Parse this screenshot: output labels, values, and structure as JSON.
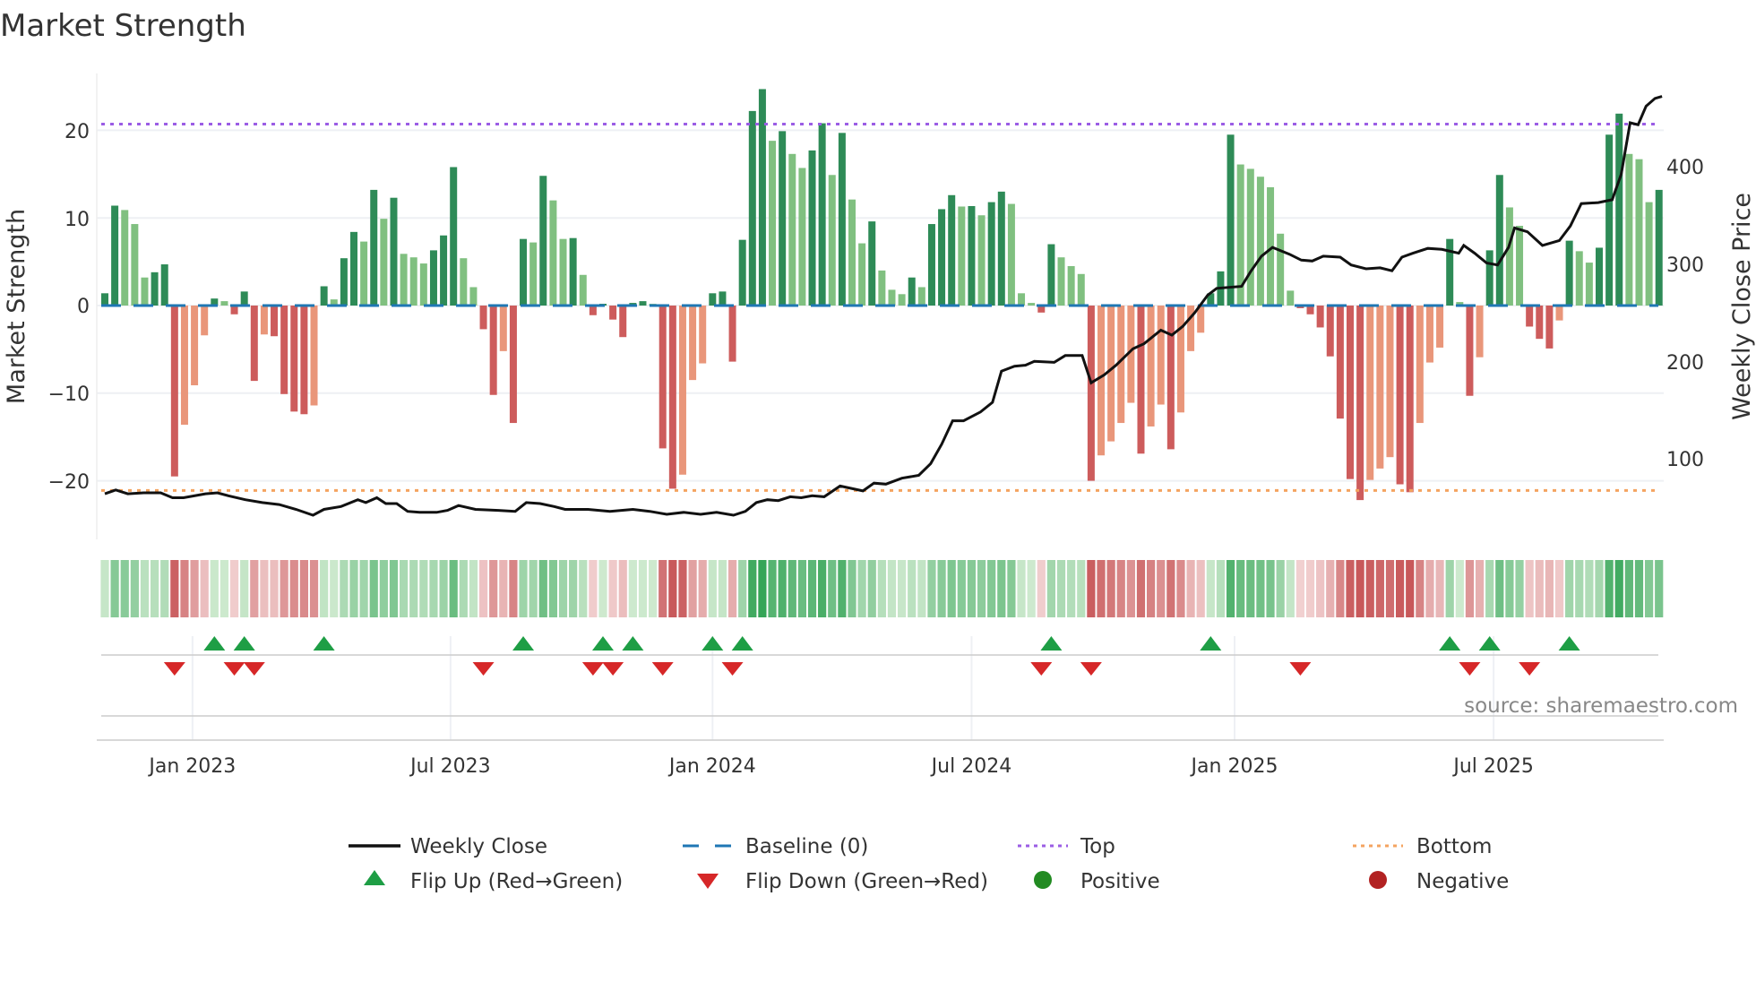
{
  "chart_data": {
    "type": "bar",
    "title": "Market Strength",
    "ylabel": "Market Strength",
    "y2label": "Weekly Close Price",
    "ylim": [
      -26.9,
      26.5
    ],
    "y2lim": [
      0,
      490
    ],
    "y_ticks": [
      "20",
      "10",
      "0",
      "−10",
      "−20"
    ],
    "y_tick_values": [
      20,
      10,
      0,
      -10,
      -20
    ],
    "y2_ticks": [
      "400",
      "300",
      "200",
      "100"
    ],
    "y2_tick_values": [
      400,
      300,
      200,
      100
    ],
    "x_ticks": [
      "Jan 2023",
      "Jul 2023",
      "Jan 2024",
      "Jul 2024",
      "Jan 2025",
      "Jul 2025"
    ],
    "x_tick_weeks": [
      8.8,
      34.7,
      61,
      87,
      113.4,
      139.4
    ],
    "top_level": 20.7,
    "bottom_level": -21.1,
    "baseline": 0,
    "strength_values": [
      1.4,
      11.4,
      10.9,
      9.3,
      3.2,
      3.8,
      4.7,
      -19.5,
      -13.6,
      -9.1,
      -3.4,
      0.8,
      0.5,
      -1.0,
      1.6,
      -8.6,
      -3.3,
      -3.5,
      -10.1,
      -12.1,
      -12.4,
      -11.4,
      2.2,
      0.7,
      5.4,
      8.4,
      7.3,
      13.2,
      9.9,
      12.3,
      5.9,
      5.5,
      4.8,
      6.3,
      8.0,
      15.8,
      5.4,
      2.1,
      -2.7,
      -10.2,
      -5.2,
      -13.4,
      7.6,
      7.2,
      14.8,
      12.0,
      7.6,
      7.7,
      3.5,
      -1.1,
      0.2,
      -1.6,
      -3.6,
      0.3,
      0.5,
      0.2,
      -16.3,
      -20.9,
      -19.3,
      -8.5,
      -6.6,
      1.4,
      1.6,
      -6.4,
      7.5,
      22.2,
      24.7,
      18.8,
      19.9,
      17.3,
      15.7,
      17.7,
      20.8,
      14.9,
      19.7,
      12.1,
      7.1,
      9.6,
      4.0,
      1.8,
      1.3,
      3.2,
      2.1,
      9.3,
      11.0,
      12.6,
      11.3,
      11.35,
      10.3,
      11.8,
      13.0,
      11.6,
      1.4,
      0.3,
      -0.8,
      7.0,
      5.5,
      4.5,
      3.6,
      -20.0,
      -17.1,
      -15.5,
      -13.4,
      -11.1,
      -16.9,
      -13.8,
      -11.3,
      -16.4,
      -12.2,
      -5.2,
      -3.1,
      1.4,
      3.9,
      19.5,
      16.1,
      15.6,
      14.7,
      13.5,
      8.2,
      1.7,
      -0.3,
      -1.0,
      -2.5,
      -5.8,
      -12.9,
      -19.8,
      -22.2,
      -19.9,
      -18.6,
      -17.3,
      -20.4,
      -21.3,
      -13.4,
      -6.5,
      -4.8,
      7.6,
      0.4,
      -10.3,
      -5.9,
      6.3,
      14.9,
      11.2,
      9.1,
      -2.4,
      -3.8,
      -4.9,
      -1.7,
      7.4,
      6.2,
      4.9,
      6.6,
      19.5,
      21.9,
      17.3,
      16.7,
      11.8,
      13.2
    ],
    "weekly_close_points": [
      [
        0,
        64
      ],
      [
        1.1,
        68
      ],
      [
        2.3,
        64
      ],
      [
        3.9,
        65
      ],
      [
        5.6,
        65
      ],
      [
        6.8,
        60
      ],
      [
        7.9,
        60
      ],
      [
        10.1,
        64
      ],
      [
        11.3,
        65
      ],
      [
        12.4,
        62
      ],
      [
        14.1,
        58
      ],
      [
        15.8,
        55
      ],
      [
        17.5,
        53
      ],
      [
        19.2,
        48
      ],
      [
        20.9,
        42
      ],
      [
        22,
        48
      ],
      [
        23.7,
        51
      ],
      [
        25.4,
        58
      ],
      [
        26.2,
        55
      ],
      [
        27.3,
        60
      ],
      [
        28.2,
        54
      ],
      [
        29.3,
        54
      ],
      [
        30.4,
        46
      ],
      [
        31.6,
        45
      ],
      [
        33.3,
        45
      ],
      [
        34.4,
        47
      ],
      [
        35.5,
        52
      ],
      [
        37.2,
        48
      ],
      [
        39.5,
        47
      ],
      [
        41.2,
        46
      ],
      [
        42.3,
        55
      ],
      [
        43.7,
        54
      ],
      [
        45.1,
        51
      ],
      [
        46.2,
        48
      ],
      [
        48.5,
        48
      ],
      [
        50.7,
        46
      ],
      [
        53,
        48
      ],
      [
        54.7,
        46
      ],
      [
        56.4,
        43
      ],
      [
        58.1,
        45
      ],
      [
        59.8,
        43
      ],
      [
        61.4,
        45
      ],
      [
        63.1,
        42
      ],
      [
        64.3,
        46
      ],
      [
        65.4,
        55
      ],
      [
        66.5,
        58
      ],
      [
        67.6,
        57
      ],
      [
        68.8,
        61
      ],
      [
        69.9,
        60
      ],
      [
        71,
        62
      ],
      [
        72.2,
        61
      ],
      [
        73.8,
        72
      ],
      [
        76.1,
        67
      ],
      [
        77.2,
        75
      ],
      [
        78.4,
        74
      ],
      [
        80,
        80
      ],
      [
        81.7,
        83
      ],
      [
        82.9,
        95
      ],
      [
        84,
        115
      ],
      [
        85.1,
        139
      ],
      [
        86.2,
        139
      ],
      [
        87.9,
        148
      ],
      [
        89.1,
        158
      ],
      [
        90,
        190
      ],
      [
        91.3,
        195
      ],
      [
        92.4,
        196
      ],
      [
        93.3,
        200
      ],
      [
        95.3,
        199
      ],
      [
        96.4,
        206
      ],
      [
        98.1,
        206
      ],
      [
        99,
        178
      ],
      [
        100.3,
        186
      ],
      [
        101.5,
        196
      ],
      [
        103.2,
        213
      ],
      [
        104.3,
        218
      ],
      [
        106,
        232
      ],
      [
        107.1,
        227
      ],
      [
        108.2,
        236
      ],
      [
        109.4,
        250
      ],
      [
        110.7,
        268
      ],
      [
        111.6,
        275
      ],
      [
        114.1,
        277
      ],
      [
        115,
        292
      ],
      [
        116.1,
        308
      ],
      [
        117.2,
        317
      ],
      [
        118.9,
        310
      ],
      [
        120.1,
        304
      ],
      [
        121.2,
        303
      ],
      [
        122.3,
        308
      ],
      [
        124,
        307
      ],
      [
        125.1,
        299
      ],
      [
        126.6,
        295
      ],
      [
        128,
        296
      ],
      [
        129.2,
        293
      ],
      [
        130.2,
        307
      ],
      [
        131.3,
        311
      ],
      [
        132.8,
        316
      ],
      [
        134.2,
        315
      ],
      [
        135.9,
        311
      ],
      [
        136.4,
        319
      ],
      [
        137.5,
        311
      ],
      [
        138.7,
        301
      ],
      [
        139.8,
        299
      ],
      [
        140.9,
        317
      ],
      [
        141.5,
        337
      ],
      [
        142.8,
        333
      ],
      [
        144.3,
        319
      ],
      [
        146,
        324
      ],
      [
        147.1,
        339
      ],
      [
        148.2,
        362
      ],
      [
        149.9,
        363
      ],
      [
        151.3,
        366
      ],
      [
        152.2,
        392
      ],
      [
        153.1,
        445
      ],
      [
        153.9,
        443
      ],
      [
        154.7,
        462
      ],
      [
        155.6,
        470
      ],
      [
        156.3,
        472
      ]
    ],
    "flip_up_weeks": [
      11,
      14,
      22,
      42,
      50,
      53,
      61,
      64,
      95,
      111,
      135,
      139,
      147
    ],
    "flip_down_weeks": [
      7,
      13,
      15,
      38,
      49,
      51,
      56,
      63,
      94,
      99,
      120,
      137,
      143
    ],
    "legend": {
      "placement": "bottom",
      "weekly_close": "Weekly Close",
      "baseline": "Baseline (0)",
      "top": "Top",
      "bottom": "Bottom",
      "flip_up": "Flip Up (Red→Green)",
      "flip_down": "Flip Down (Green→Red)",
      "positive": "Positive",
      "negative": "Negative"
    },
    "source": "source: sharemaestro.com",
    "colors": {
      "pos_rising": "#2e8b57",
      "pos_falling": "#80c080",
      "neg_falling": "#cd5c5c",
      "neg_rising": "#e9967a",
      "top": "#9b5de5",
      "bottom": "#f4a460",
      "baseline": "#1f77b4",
      "flip_up": "#1e9e45",
      "flip_down": "#d62728",
      "positive": "#228b22",
      "negative": "#b22222",
      "price": "#111111"
    }
  }
}
